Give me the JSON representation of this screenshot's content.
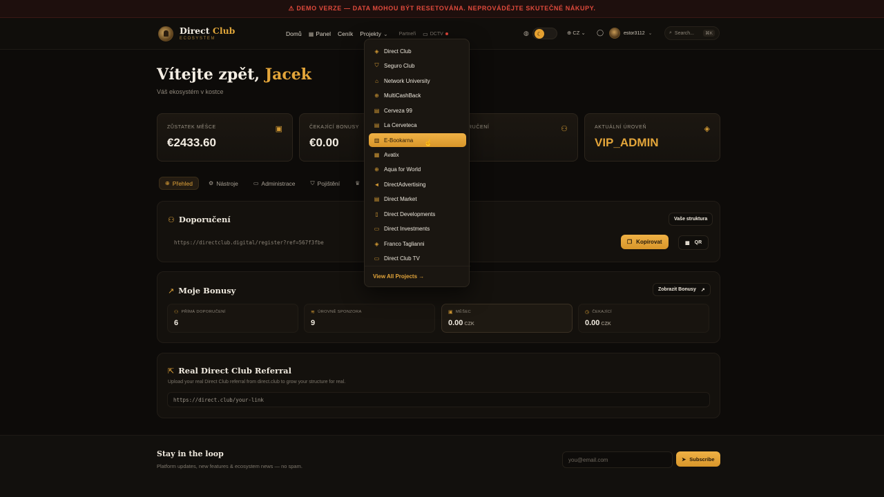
{
  "banner": {
    "icon": "warning-icon",
    "text": "⚠ DEMO VERZE — DATA MOHOU BÝT RESETOVÁNA. NEPROVÁDĚJTE SKUTEČNÉ NÁKUPY."
  },
  "header": {
    "logo_word1": "Direct",
    "logo_word2": "Club",
    "logo_tagline": "ECOSYSTEM",
    "nav": {
      "home": "Domů",
      "panel": "Panel",
      "pricing": "Ceník",
      "projects": "Projekty",
      "partners": "Partneři",
      "dctv": "DCTV"
    },
    "lang": "CZ",
    "username": "estor3112",
    "search_placeholder": "Search...",
    "search_shortcut": "⌘K"
  },
  "hero": {
    "greeting": "Vítejte zpět,",
    "name": "Jacek",
    "subtitle": "Váš ekosystém v kostce"
  },
  "stats": {
    "balance": {
      "label": "ZŮSTATEK MĚŠCE",
      "value": "€2433.60"
    },
    "pending": {
      "label": "ČEKAJÍCÍ BONUSY",
      "value": "€0.00"
    },
    "referrals": {
      "label": "DOPORUČENÍ"
    },
    "level": {
      "label": "AKTUÁLNÍ ÚROVEŇ",
      "value": "VIP_ADMIN"
    }
  },
  "tabs": [
    "Přehled",
    "Nástroje",
    "Administrace",
    "Pojištění"
  ],
  "referral": {
    "title": "Doporučení",
    "structure_button": "Vaše struktura",
    "link": "https://directclub.digital/register?ref=567f3fbe",
    "copy_button": "Kopírovat",
    "qr_button": "QR"
  },
  "bonuses": {
    "title": "Moje Bonusy",
    "show_button": "Zobrazit Bonusy",
    "cards": [
      {
        "label": "PŘÍMÁ DOPORUČENÍ",
        "value": "6",
        "currency": ""
      },
      {
        "label": "ÚROVNĚ SPONZORA",
        "value": "9",
        "currency": ""
      },
      {
        "label": "MĚŠEC",
        "value": "0.00",
        "currency": "CZK"
      },
      {
        "label": "ČEKAJÍCÍ",
        "value": "0.00",
        "currency": "CZK"
      }
    ]
  },
  "real_referral": {
    "title": "Real Direct Club Referral",
    "description": "Upload your real Direct Club referral from direct.club to grow your structure for real.",
    "placeholder": "https://direct.club/your-link"
  },
  "footer": {
    "title": "Stay in the loop",
    "subtitle": "Platform updates, new features & ecosystem news — no spam.",
    "email_placeholder": "you@email.com",
    "subscribe": "Subscribe"
  },
  "projects_dropdown": {
    "items": [
      "Direct Club",
      "Seguro Club",
      "Network University",
      "MultiCashBack",
      "Cerveza 99",
      "La Cerveteca",
      "E-Bookarna",
      "Avatix",
      "Aqua for World",
      "DirectAdvertising",
      "Direct Market",
      "Direct Developments",
      "Direct Investments",
      "Franco Taglianni",
      "Direct Club TV"
    ],
    "active_index": 6,
    "view_all": "View All Projects →"
  },
  "colors": {
    "accent": "#e3a53a",
    "background": "#0d0b09",
    "banner_text": "#e04a3c"
  }
}
